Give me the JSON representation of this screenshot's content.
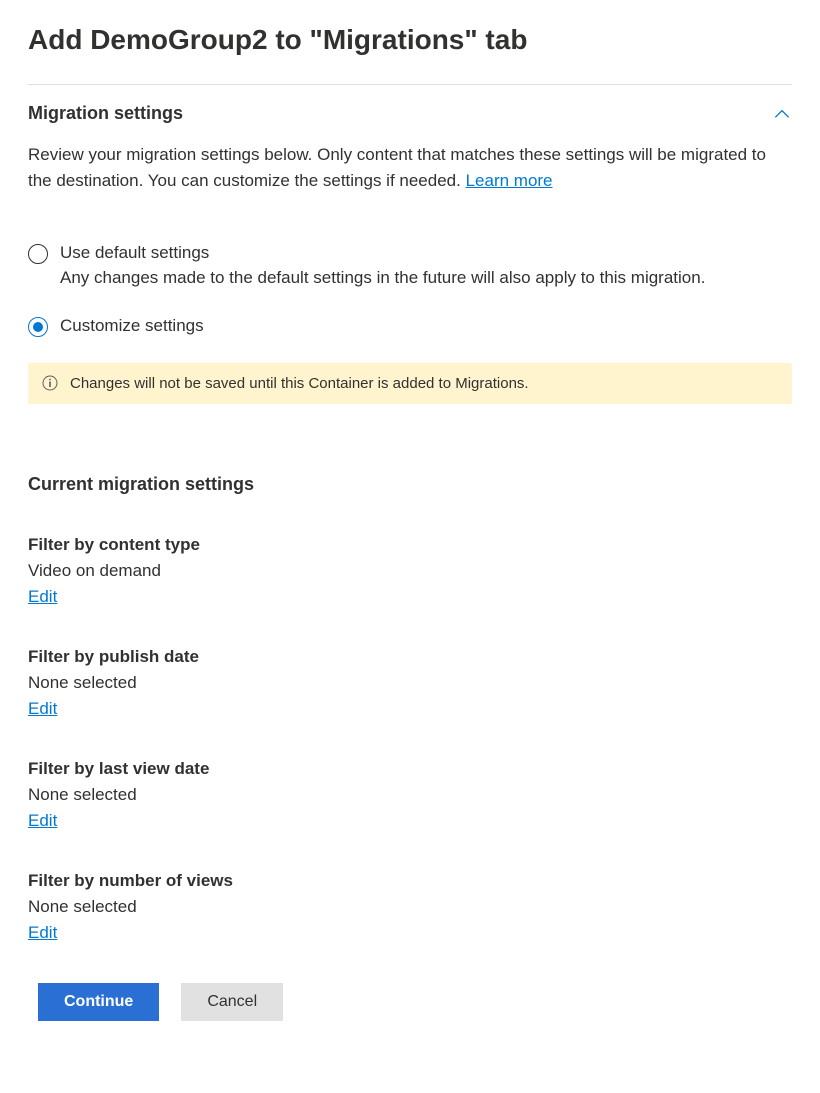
{
  "page_title": "Add DemoGroup2 to \"Migrations\" tab",
  "section": {
    "title": "Migration settings",
    "description_text": "Review your migration settings below. Only content that matches these settings will be migrated to the destination. You can customize the settings if needed. ",
    "learn_more": "Learn more"
  },
  "radio": {
    "default": {
      "label": "Use default settings",
      "subtext": "Any changes made to the default settings in the future will also apply to this migration.",
      "selected": false
    },
    "customize": {
      "label": "Customize settings",
      "selected": true
    }
  },
  "info_bar": {
    "message": "Changes will not be saved until this Container is added to Migrations."
  },
  "current": {
    "title": "Current migration settings",
    "filters": [
      {
        "label": "Filter by content type",
        "value": "Video on demand",
        "edit": "Edit"
      },
      {
        "label": "Filter by publish date",
        "value": "None selected",
        "edit": "Edit"
      },
      {
        "label": "Filter by last view date",
        "value": "None selected",
        "edit": "Edit"
      },
      {
        "label": "Filter by number of views",
        "value": "None selected",
        "edit": "Edit"
      }
    ]
  },
  "actions": {
    "continue": "Continue",
    "cancel": "Cancel"
  }
}
